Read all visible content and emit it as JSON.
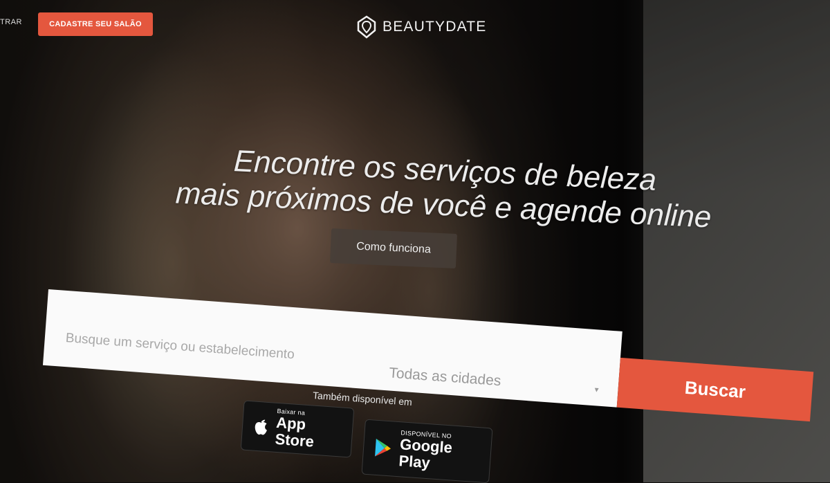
{
  "header": {
    "login_label": "TRAR",
    "cta_label": "CADASTRE SEU SALÃO",
    "brand": "BEAUTYDATE"
  },
  "hero": {
    "headline_line1": "Encontre os serviços de beleza",
    "headline_line2": "mais próximos de você e agende online",
    "how_it_works": "Como funciona"
  },
  "search": {
    "placeholder": "Busque um serviço ou estabelecimento",
    "city_selected": "Todas as cidades",
    "button_label": "Buscar"
  },
  "stores": {
    "also_available": "Também disponível em",
    "app_store_small": "Baixar na",
    "app_store_big": "App Store",
    "google_play_small": "DISPONÍVEL NO",
    "google_play_big": "Google Play"
  },
  "colors": {
    "accent": "#e4573e"
  }
}
